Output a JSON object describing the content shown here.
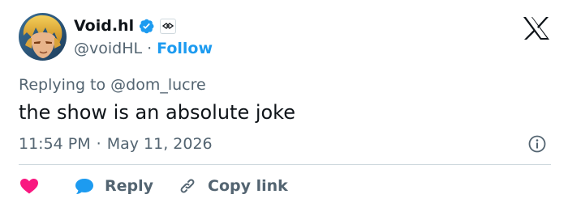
{
  "author": {
    "display_name": "Void.hl",
    "handle": "@voidHL",
    "separator": "·",
    "follow_label": "Follow"
  },
  "tweet": {
    "replying_prefix": "Replying to",
    "replying_to": "@dom_lucre",
    "text": "the show is an absolute joke",
    "time": "11:54 PM",
    "dot": "·",
    "date": "May 11, 2026"
  },
  "actions": {
    "reply_label": "Reply",
    "copy_link_label": "Copy link"
  },
  "icons": {
    "verified": "verified-badge-icon",
    "affiliation": "affiliate-badge-icon",
    "brand": "x-logo-icon",
    "info": "info-icon",
    "like": "heart-icon",
    "reply": "speech-bubble-icon",
    "copy_link": "link-icon"
  },
  "colors": {
    "accent": "#1d9bf0",
    "like": "#f91880",
    "secondary_text": "#536471",
    "primary_text": "#0f1419",
    "divider": "#cfd9de"
  }
}
